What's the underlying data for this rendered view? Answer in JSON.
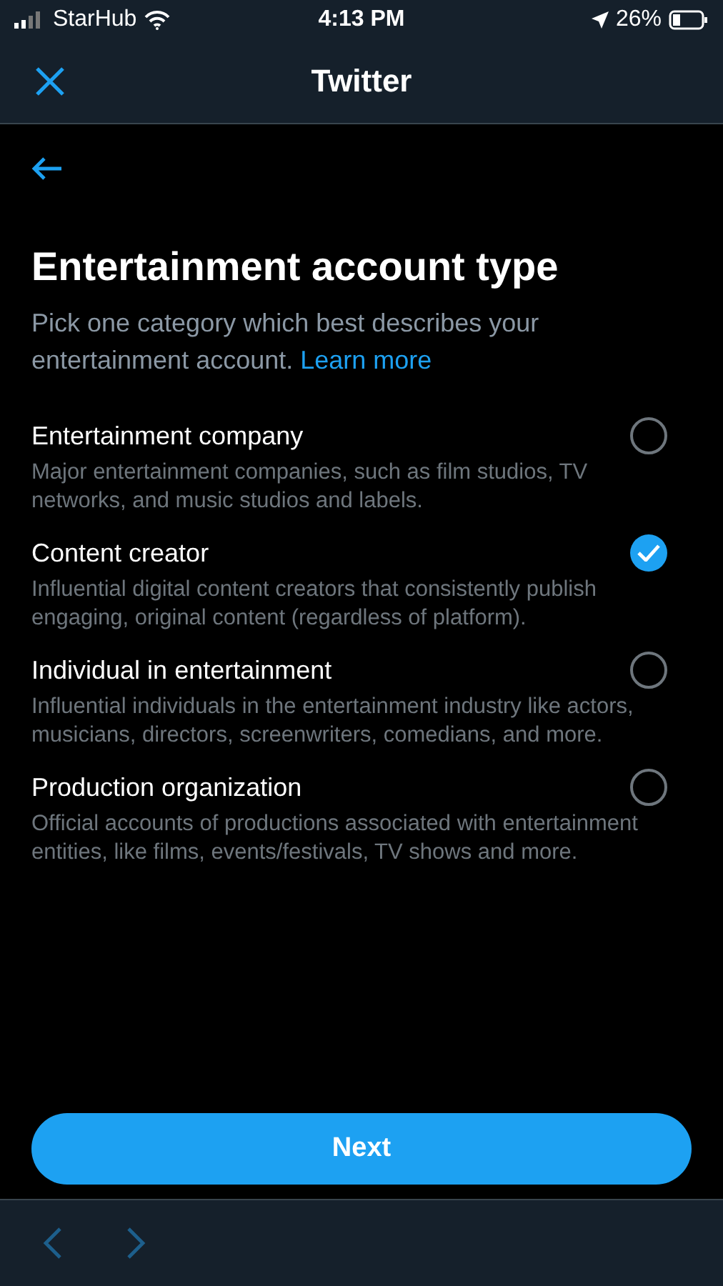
{
  "status_bar": {
    "carrier": "StarHub",
    "time": "4:13 PM",
    "battery": "26%"
  },
  "header": {
    "title": "Twitter"
  },
  "page": {
    "heading": "Entertainment account type",
    "description": "Pick one category which best describes your entertainment account.",
    "link": "Learn more"
  },
  "options": [
    {
      "label": "Entertainment company",
      "description": "Major entertainment companies, such as film studios, TV networks, and music studios and labels.",
      "selected": false
    },
    {
      "label": "Content creator",
      "description": "Influential digital content creators that consistently publish engaging, original content (regardless of platform).",
      "selected": true
    },
    {
      "label": "Individual in entertainment",
      "description": "Influential individuals in the entertainment industry like actors, musicians, directors, screenwriters, comedians, and more.",
      "selected": false
    },
    {
      "label": "Production organization",
      "description": "Official accounts of productions associated with entertainment entities, like films, events/festivals, TV shows and more.",
      "selected": false
    }
  ],
  "next_button": {
    "label": "Next"
  }
}
